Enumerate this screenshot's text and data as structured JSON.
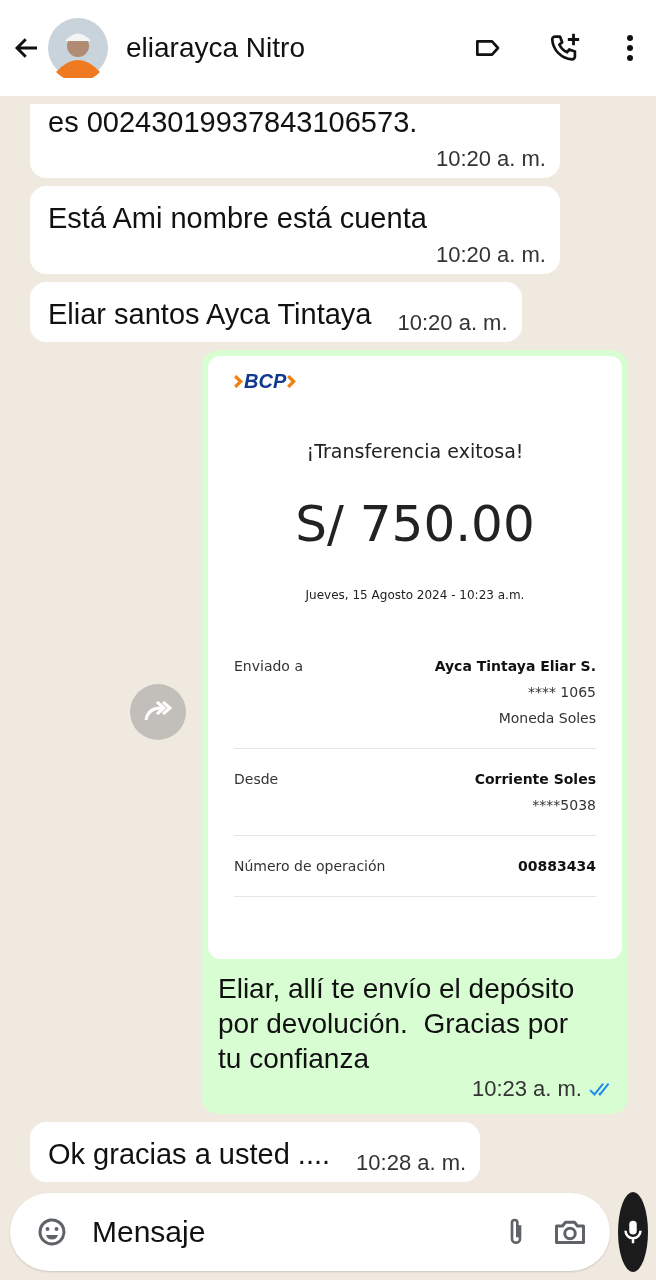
{
  "header": {
    "contact_name": "eliarayca Nitro"
  },
  "messages": [
    {
      "kind": "text",
      "outgoing": false,
      "text": "es 00243019937843106573.",
      "time": "10:20 a. m."
    },
    {
      "kind": "text",
      "outgoing": false,
      "text": "Está Ami nombre está cuenta",
      "time": "10:20 a. m."
    },
    {
      "kind": "text",
      "outgoing": false,
      "text": "Eliar santos Ayca Tintaya",
      "time": "10:20 a. m."
    },
    {
      "kind": "receipt",
      "outgoing": true,
      "receipt": {
        "logo": "BCP",
        "title": "¡Transferencia exitosa!",
        "amount": "S/ 750.00",
        "date": "Jueves, 15 Agosto 2024 - 10:23 a.m.",
        "rows": [
          {
            "label": "Enviado a",
            "values": [
              {
                "text": "Ayca Tintaya Eliar S.",
                "strong": true
              },
              {
                "text": "**** 1065",
                "strong": false
              },
              {
                "text": "Moneda Soles",
                "strong": false
              }
            ]
          },
          {
            "label": "Desde",
            "values": [
              {
                "text": "Corriente Soles",
                "strong": true
              },
              {
                "text": "****5038",
                "strong": false
              }
            ]
          },
          {
            "label": "Número de operación",
            "values": [
              {
                "text": "00883434",
                "strong": true
              }
            ]
          }
        ]
      },
      "text": "Eliar, allí te envío el depósito por devolución.  Gracias por tu confianza",
      "time": "10:23 a. m.",
      "read": true
    },
    {
      "kind": "text",
      "outgoing": false,
      "text": "Ok gracias a usted ....",
      "time": "10:28 a. m."
    }
  ],
  "composer": {
    "placeholder": "Mensaje"
  }
}
